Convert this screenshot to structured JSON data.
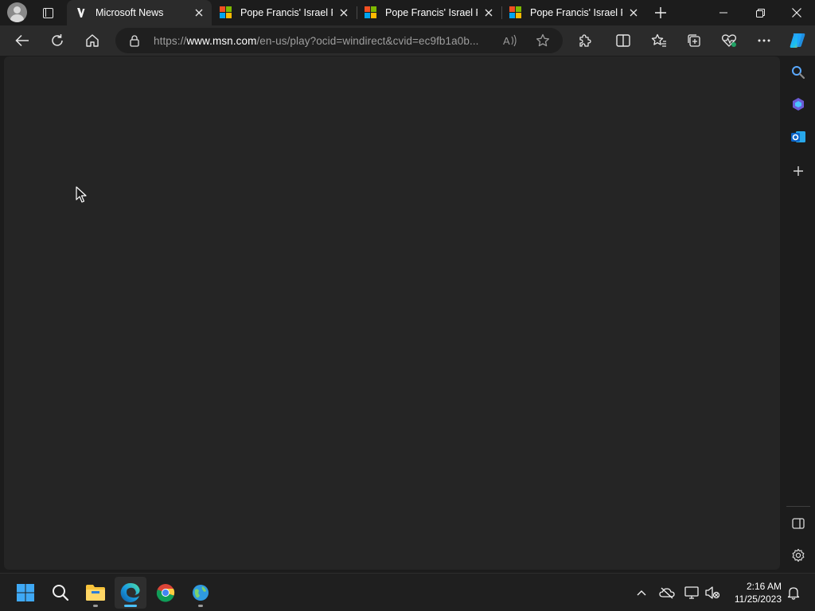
{
  "browser": {
    "tabs": [
      {
        "title": "Microsoft News",
        "active": true,
        "favicon": "msn-news-icon"
      },
      {
        "title": "Pope Francis' Israel Re",
        "active": false,
        "favicon": "microsoft-logo-icon"
      },
      {
        "title": "Pope Francis' Israel Re",
        "active": false,
        "favicon": "microsoft-logo-icon"
      },
      {
        "title": "Pope Francis' Israel Re",
        "active": false,
        "favicon": "microsoft-logo-icon"
      }
    ],
    "address": {
      "scheme": "https://",
      "host": "www.msn.com",
      "path": "/en-us/play?ocid=windirect&cvid=ec9fb1a0b..."
    },
    "colors": {
      "titlebar": "#1c1c1c",
      "toolbar": "#2b2b2b",
      "content": "#252525",
      "accent": "#4cc2ff"
    }
  },
  "taskbar": {
    "time": "2:16 AM",
    "date": "11/25/2023",
    "apps": [
      "start-icon",
      "search-icon",
      "file-explorer-icon",
      "edge-icon",
      "chrome-icon",
      "globe-app-icon"
    ]
  }
}
